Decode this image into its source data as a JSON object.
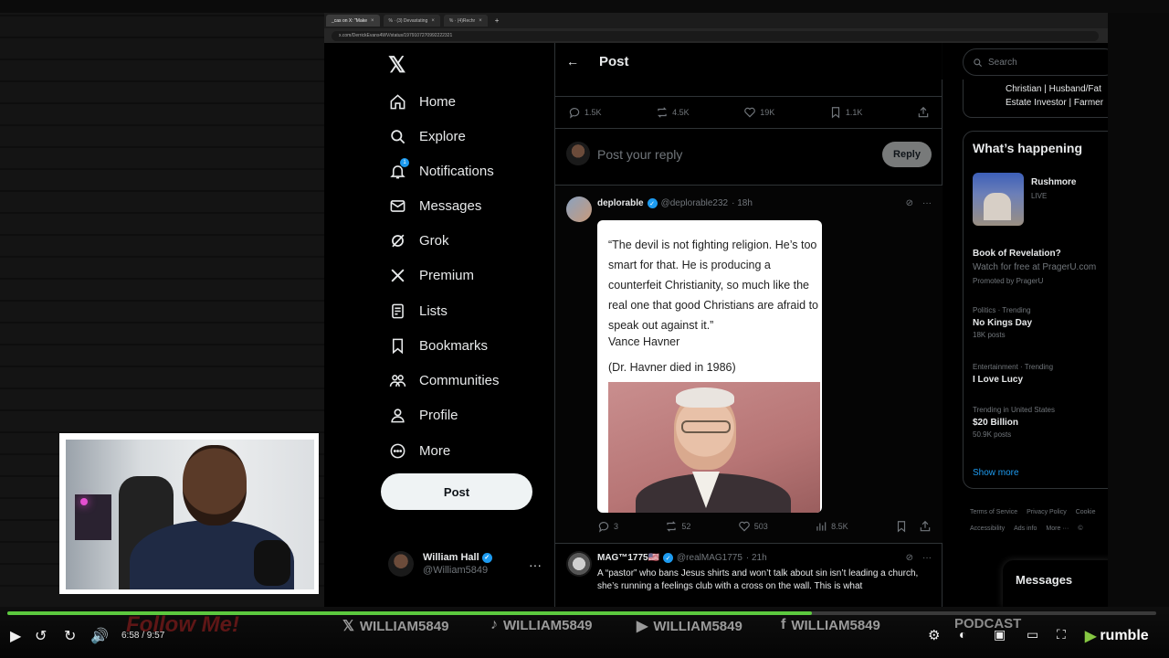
{
  "browser": {
    "tabs": [
      {
        "label": "_cas on X: \"Make",
        "active": true
      },
      {
        "label": "% · (3) Devastating",
        "active": false
      },
      {
        "label": "% · (4)Rechr",
        "active": false
      }
    ],
    "new_tab": "+",
    "url": "x.com/DerrickEvans4WV/status/1979107270992222321"
  },
  "nav": {
    "logo": "𝕏",
    "items": [
      {
        "label": "Home",
        "icon": "home-icon"
      },
      {
        "label": "Explore",
        "icon": "search-icon"
      },
      {
        "label": "Notifications",
        "icon": "bell-icon",
        "badge": "1"
      },
      {
        "label": "Messages",
        "icon": "envelope-icon"
      },
      {
        "label": "Grok",
        "icon": "grok-icon"
      },
      {
        "label": "Premium",
        "icon": "x-premium-icon"
      },
      {
        "label": "Lists",
        "icon": "list-icon"
      },
      {
        "label": "Bookmarks",
        "icon": "bookmark-icon"
      },
      {
        "label": "Communities",
        "icon": "communities-icon"
      },
      {
        "label": "Profile",
        "icon": "person-icon"
      },
      {
        "label": "More",
        "icon": "more-circle-icon"
      }
    ],
    "post_button": "Post",
    "user": {
      "name": "William Hall",
      "handle": "@William5849",
      "more": "···"
    }
  },
  "main": {
    "header": {
      "back": "←",
      "title": "Post"
    },
    "stats": {
      "replies": "1.5K",
      "reposts": "4.5K",
      "likes": "19K",
      "bookmarks": "1.1K"
    },
    "reply": {
      "placeholder": "Post your reply",
      "button": "Reply"
    },
    "tweet": {
      "name": "deplorable",
      "handle": "@deplorable232",
      "time": "· 18h",
      "quote": "“The devil is not fighting religion. He’s too smart for that. He is producing a counterfeit Christianity, so much like the real one that good Christians are afraid to speak out against it.”",
      "author": "Vance Havner",
      "note": "(Dr. Havner died in 1986)",
      "stats": {
        "replies": "3",
        "reposts": "52",
        "likes": "503",
        "views": "8.5K"
      }
    },
    "tweet2": {
      "name": "MAG™1775🇺🇸",
      "handle": "@realMAG1775",
      "time": "· 21h",
      "text": "A “pastor” who bans Jesus shirts and won’t talk about sin isn’t leading a church, she’s running a feelings club with a cross on the wall. This is what"
    }
  },
  "right": {
    "search_placeholder": "Search",
    "bio_line1": "Christian | Husband/Fat",
    "bio_line2": "Estate Investor | Farmer",
    "happening": {
      "title": "What’s happening",
      "live": {
        "name": "Rushmore",
        "status": "LIVE"
      },
      "trends": [
        {
          "meta": "",
          "name": "Book of Revelation?",
          "sub": "Watch for free at PragerU.com",
          "count": "Promoted by PragerU"
        },
        {
          "meta": "Politics · Trending",
          "name": "No Kings Day",
          "sub": "",
          "count": "18K posts"
        },
        {
          "meta": "Entertainment · Trending",
          "name": "I Love Lucy",
          "sub": "",
          "count": ""
        },
        {
          "meta": "Trending in United States",
          "name": "$20 Billion",
          "sub": "",
          "count": "50.9K posts"
        }
      ],
      "show_more": "Show more"
    },
    "footer": [
      "Terms of Service",
      "Privacy Policy",
      "Cookie",
      "Accessibility",
      "Ads info",
      "More ···",
      "©"
    ],
    "messages": "Messages"
  },
  "player": {
    "time": "6:58 / 9:57",
    "progress": 0.7,
    "follow": "Follow Me!",
    "socials": [
      {
        "icon": "x-logo-icon",
        "glyph": "𝕏",
        "label": "WILLIAM5849"
      },
      {
        "icon": "tiktok-icon",
        "glyph": "♪",
        "label": "WILLIAM5849"
      },
      {
        "icon": "rumble-play-icon",
        "glyph": "▶",
        "label": "WILLIAM5849"
      },
      {
        "icon": "facebook-icon",
        "glyph": "f",
        "label": "WILLIAM5849"
      }
    ],
    "podcast": "PODCAST",
    "brand": "rumble"
  }
}
